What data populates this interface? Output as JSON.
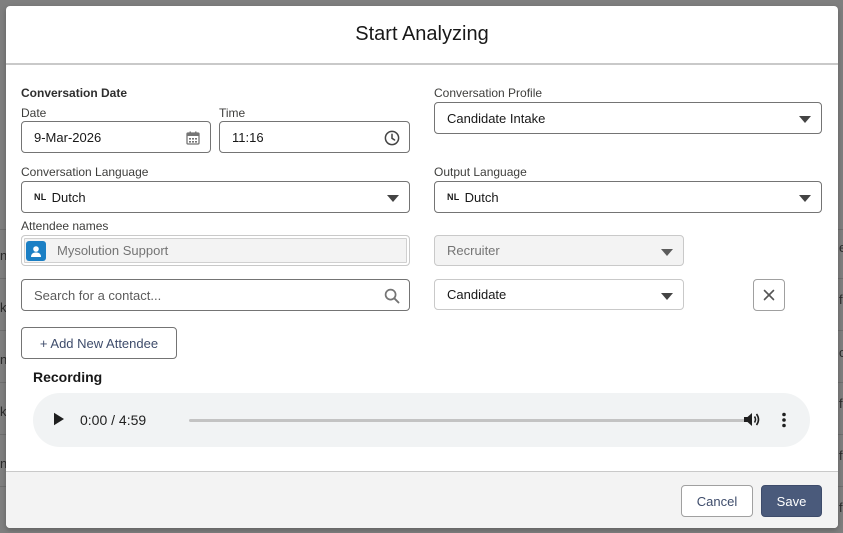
{
  "background": {
    "row_fragments": [
      "e",
      "nt",
      "f",
      "ki",
      "c",
      "nt",
      "f",
      "ke",
      "f",
      "nt",
      "f"
    ]
  },
  "modal": {
    "title": "Start Analyzing"
  },
  "conversation_date": {
    "section_label": "Conversation Date",
    "date_label": "Date",
    "date_value": "9-Mar-2026",
    "time_label": "Time",
    "time_value": "11:16"
  },
  "conversation_profile": {
    "label": "Conversation Profile",
    "value": "Candidate Intake"
  },
  "conversation_language": {
    "label": "Conversation Language",
    "flag": "NL",
    "value": "Dutch"
  },
  "output_language": {
    "label": "Output Language",
    "flag": "NL",
    "value": "Dutch"
  },
  "attendees": {
    "label": "Attendee names",
    "rows": [
      {
        "name": "Mysolution Support",
        "role": "Recruiter"
      }
    ],
    "search_placeholder": "Search for a contact...",
    "new_role": "Candidate",
    "add_button": "+ Add New Attendee"
  },
  "recording": {
    "label": "Recording",
    "time_display": "0:00 / 4:59",
    "progress": 0
  },
  "footer": {
    "cancel_label": "Cancel",
    "save_label": "Save"
  },
  "icons": {
    "calendar": "calendar-icon",
    "clock": "clock-icon",
    "search": "search-icon",
    "close": "close-icon",
    "play": "play-icon",
    "volume": "volume-icon",
    "more": "more-vertical-icon",
    "contact": "contact-icon"
  },
  "colors": {
    "brand_button": "#4a5a7b",
    "avatar": "#1b7fc4",
    "overlay": "#8a8a8a"
  }
}
